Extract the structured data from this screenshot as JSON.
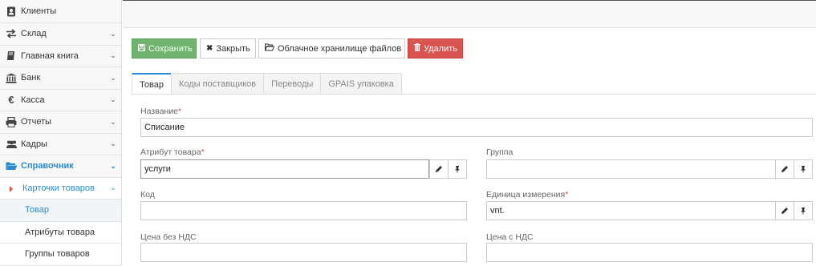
{
  "sidebar": {
    "items": [
      {
        "label": "Клиенты",
        "icon": "address-book-icon"
      },
      {
        "label": "Склад",
        "icon": "exchange-icon"
      },
      {
        "label": "Главная книга",
        "icon": "book-icon"
      },
      {
        "label": "Банк",
        "icon": "bank-icon"
      },
      {
        "label": "Касса",
        "icon": "euro-icon"
      },
      {
        "label": "Отчеты",
        "icon": "printer-icon"
      },
      {
        "label": "Кадры",
        "icon": "users-icon"
      },
      {
        "label": "Справочник",
        "icon": "folder-open-icon"
      }
    ],
    "sub": {
      "label": "Карточки товаров"
    },
    "leaves": [
      {
        "label": "Товар"
      },
      {
        "label": "Атрибуты товара"
      },
      {
        "label": "Группы товаров"
      }
    ]
  },
  "toolbar": {
    "save": "Сохранить",
    "close": "Закрыть",
    "cloud": "Облачное хранилище файлов",
    "delete": "Удалить"
  },
  "tabs": [
    "Товар",
    "Коды поставщиков",
    "Переводы",
    "GPAIS упаковка"
  ],
  "form": {
    "name_label": "Название",
    "name_value": "Списание",
    "attr_label": "Атрибут товара",
    "attr_value": "услуги",
    "group_label": "Группа",
    "group_value": "",
    "code_label": "Код",
    "code_value": "",
    "unit_label": "Единица измерения",
    "unit_value": "vnt.",
    "price_net_label": "Цена без НДС",
    "price_net_value": "",
    "price_vat_label": "Цена с НДС",
    "price_vat_value": ""
  },
  "colors": {
    "accent": "#2a8bd0",
    "save": "#6fb36f",
    "delete": "#d9534f"
  }
}
